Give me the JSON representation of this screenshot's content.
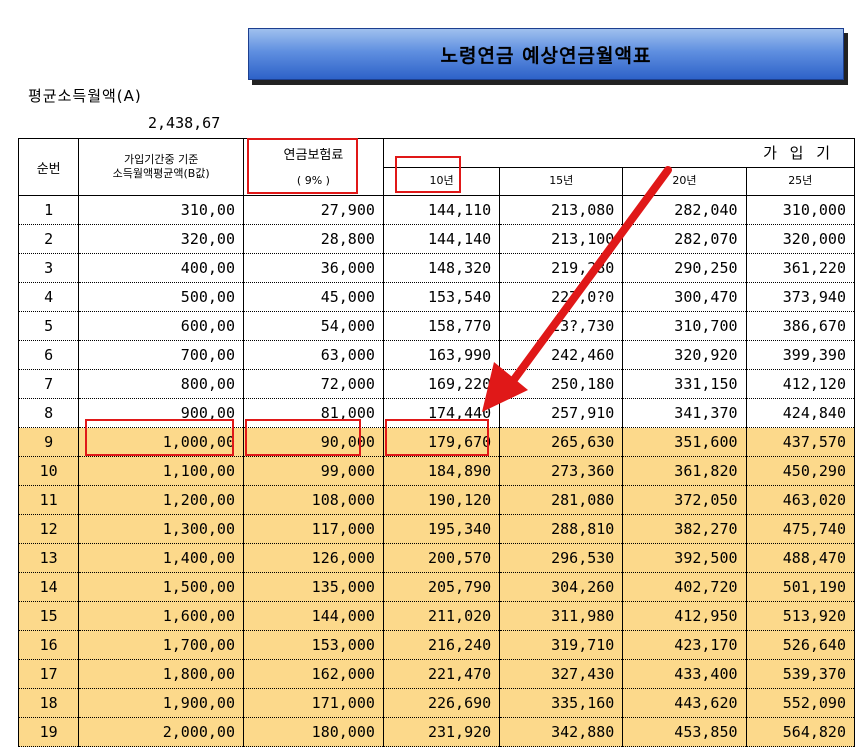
{
  "title": "노령연금 예상연금월액표",
  "avg_income_label": "평균소득월액(A)",
  "avg_income_value": "2,438,67",
  "headers": {
    "seq": "순번",
    "basis_line1": "가입기간중 기준",
    "basis_line2": "소득월액평균액(B값)",
    "premium_line1": "연금보험료",
    "premium_line2": "( 9% )",
    "period_group": "가 입 기",
    "y10": "10년",
    "y15": "15년",
    "y20": "20년",
    "y25": "25년"
  },
  "rows": [
    {
      "n": "1",
      "b": "310,00",
      "p": "27,900",
      "y10": "144,110",
      "y15": "213,080",
      "y20": "282,040",
      "y25": "310,000"
    },
    {
      "n": "2",
      "b": "320,00",
      "p": "28,800",
      "y10": "144,140",
      "y15": "213,100",
      "y20": "282,070",
      "y25": "320,000"
    },
    {
      "n": "3",
      "b": "400,00",
      "p": "36,000",
      "y10": "148,320",
      "y15": "219,280",
      "y20": "290,250",
      "y25": "361,220"
    },
    {
      "n": "4",
      "b": "500,00",
      "p": "45,000",
      "y10": "153,540",
      "y15": "227,0?0",
      "y20": "300,470",
      "y25": "373,940"
    },
    {
      "n": "5",
      "b": "600,00",
      "p": "54,000",
      "y10": "158,770",
      "y15": "23?,730",
      "y20": "310,700",
      "y25": "386,670"
    },
    {
      "n": "6",
      "b": "700,00",
      "p": "63,000",
      "y10": "163,990",
      "y15": "242,460",
      "y20": "320,920",
      "y25": "399,390"
    },
    {
      "n": "7",
      "b": "800,00",
      "p": "72,000",
      "y10": "169,220",
      "y15": "250,180",
      "y20": "331,150",
      "y25": "412,120"
    },
    {
      "n": "8",
      "b": "900,00",
      "p": "81,000",
      "y10": "174,440",
      "y15": "257,910",
      "y20": "341,370",
      "y25": "424,840"
    },
    {
      "n": "9",
      "b": "1,000,00",
      "p": "90,000",
      "y10": "179,670",
      "y15": "265,630",
      "y20": "351,600",
      "y25": "437,570"
    },
    {
      "n": "10",
      "b": "1,100,00",
      "p": "99,000",
      "y10": "184,890",
      "y15": "273,360",
      "y20": "361,820",
      "y25": "450,290"
    },
    {
      "n": "11",
      "b": "1,200,00",
      "p": "108,000",
      "y10": "190,120",
      "y15": "281,080",
      "y20": "372,050",
      "y25": "463,020"
    },
    {
      "n": "12",
      "b": "1,300,00",
      "p": "117,000",
      "y10": "195,340",
      "y15": "288,810",
      "y20": "382,270",
      "y25": "475,740"
    },
    {
      "n": "13",
      "b": "1,400,00",
      "p": "126,000",
      "y10": "200,570",
      "y15": "296,530",
      "y20": "392,500",
      "y25": "488,470"
    },
    {
      "n": "14",
      "b": "1,500,00",
      "p": "135,000",
      "y10": "205,790",
      "y15": "304,260",
      "y20": "402,720",
      "y25": "501,190"
    },
    {
      "n": "15",
      "b": "1,600,00",
      "p": "144,000",
      "y10": "211,020",
      "y15": "311,980",
      "y20": "412,950",
      "y25": "513,920"
    },
    {
      "n": "16",
      "b": "1,700,00",
      "p": "153,000",
      "y10": "216,240",
      "y15": "319,710",
      "y20": "423,170",
      "y25": "526,640"
    },
    {
      "n": "17",
      "b": "1,800,00",
      "p": "162,000",
      "y10": "221,470",
      "y15": "327,430",
      "y20": "433,400",
      "y25": "539,370"
    },
    {
      "n": "18",
      "b": "1,900,00",
      "p": "171,000",
      "y10": "226,690",
      "y15": "335,160",
      "y20": "443,620",
      "y25": "552,090"
    },
    {
      "n": "19",
      "b": "2,000,00",
      "p": "180,000",
      "y10": "231,920",
      "y15": "342,880",
      "y20": "453,850",
      "y25": "564,820"
    }
  ],
  "highlight_from_row": "9",
  "colors": {
    "highlight": "#fcd98b",
    "annotation_red": "#e01818",
    "title_blue": "#3b6fd4"
  }
}
